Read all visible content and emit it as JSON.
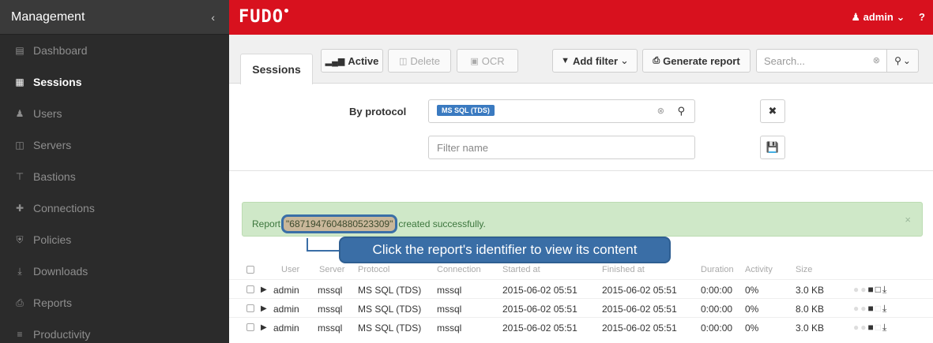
{
  "sidebar": {
    "title": "Management",
    "collapse_icon": "chevron-left-icon",
    "items": [
      {
        "label": "Dashboard",
        "icon": "dashboard-icon"
      },
      {
        "label": "Sessions",
        "icon": "film-icon",
        "active": true
      },
      {
        "label": "Users",
        "icon": "users-icon"
      },
      {
        "label": "Servers",
        "icon": "server-icon"
      },
      {
        "label": "Bastions",
        "icon": "bastion-icon"
      },
      {
        "label": "Connections",
        "icon": "connections-icon"
      },
      {
        "label": "Policies",
        "icon": "shield-icon"
      },
      {
        "label": "Downloads",
        "icon": "download-icon"
      },
      {
        "label": "Reports",
        "icon": "print-icon"
      },
      {
        "label": "Productivity",
        "icon": "list-icon"
      }
    ]
  },
  "topbar": {
    "logo": "FUDO",
    "user": "admin",
    "help": "?",
    "brand_color": "#d8111e"
  },
  "toolbar": {
    "tab": "Sessions",
    "active_label": "Active",
    "delete_label": "Delete",
    "ocr_label": "OCR",
    "add_filter_label": "Add filter",
    "generate_report_label": "Generate report",
    "search_placeholder": "Search..."
  },
  "filter": {
    "label": "By protocol",
    "tag": "MS SQL (TDS)",
    "name_placeholder": "Filter name"
  },
  "alert": {
    "prefix": "Report",
    "report_id": "\"6871947604880523309\"",
    "suffix": "created successfully.",
    "close": "×"
  },
  "tooltip": "Click the report's identifier to view its content",
  "table": {
    "columns": [
      "User",
      "Server",
      "Protocol",
      "Connection",
      "Started at",
      "Finished at",
      "Duration",
      "Activity",
      "Size"
    ],
    "rows": [
      {
        "user": "admin",
        "server": "mssql",
        "protocol": "MS SQL (TDS)",
        "connection": "mssql",
        "started": "2015-06-02 05:51",
        "finished": "2015-06-02 05:51",
        "duration": "0:00:00",
        "activity": "0%",
        "size": "3.0 KB"
      },
      {
        "user": "admin",
        "server": "mssql",
        "protocol": "MS SQL (TDS)",
        "connection": "mssql",
        "started": "2015-06-02 05:51",
        "finished": "2015-06-02 05:51",
        "duration": "0:00:00",
        "activity": "0%",
        "size": "8.0 KB"
      },
      {
        "user": "admin",
        "server": "mssql",
        "protocol": "MS SQL (TDS)",
        "connection": "mssql",
        "started": "2015-06-02 05:51",
        "finished": "2015-06-02 05:51",
        "duration": "0:00:00",
        "activity": "0%",
        "size": "3.0 KB"
      }
    ]
  }
}
